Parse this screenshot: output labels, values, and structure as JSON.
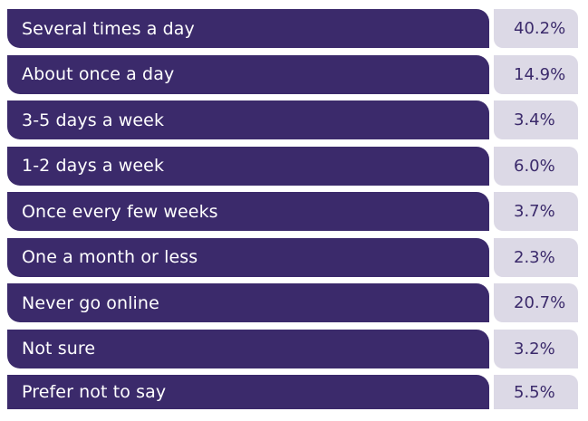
{
  "chart_data": {
    "type": "table",
    "categories": [
      "Several times a day",
      "About once a day",
      "3-5 days a week",
      "1-2 days a week",
      "Once every few weeks",
      "One a month or less",
      "Never go online",
      "Not sure",
      "Prefer not to say"
    ],
    "values": [
      40.2,
      14.9,
      3.4,
      6.0,
      3.7,
      2.3,
      20.7,
      3.2,
      5.5
    ],
    "value_labels": [
      "40.2%",
      "14.9%",
      "3.4%",
      "6.0%",
      "3.7%",
      "2.3%",
      "20.7%",
      "3.2%",
      "5.5%"
    ],
    "colors": {
      "label_bg": "#3b2a6b",
      "label_text": "#ffffff",
      "value_bg": "#dcd9e6",
      "value_text": "#3b2a6b"
    }
  }
}
